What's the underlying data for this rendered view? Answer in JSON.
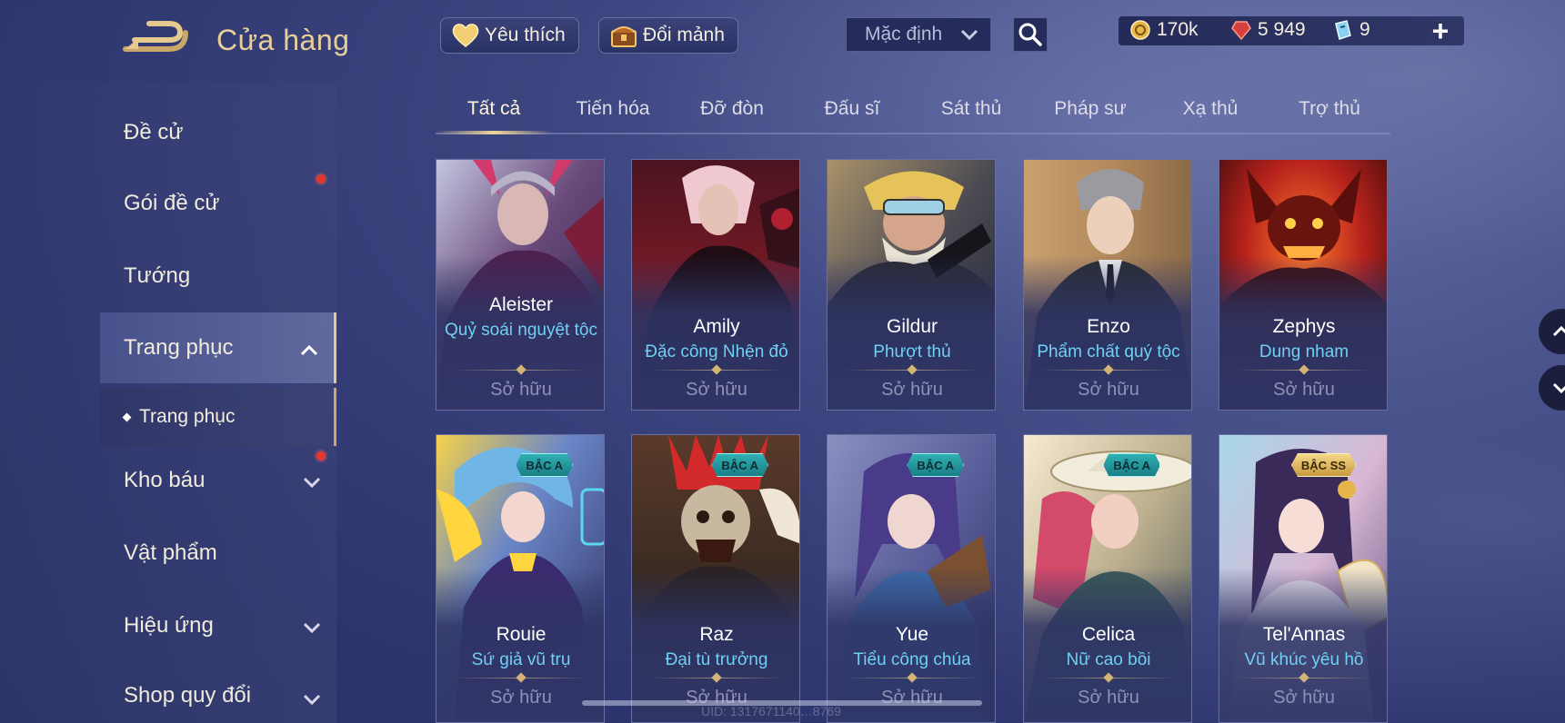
{
  "header": {
    "title": "Cửa hàng",
    "favorite_label": "Yêu thích",
    "exchange_label": "Đổi mảnh",
    "sort_value": "Mặc định",
    "back_icon": "back-arrow-icon",
    "search_icon": "search-icon"
  },
  "currencies": {
    "gold": "170k",
    "ruby": "5 949",
    "ticket": "9",
    "add": "+"
  },
  "sidebar": {
    "items": [
      {
        "label": "Đề cử"
      },
      {
        "label": "Gói đề cử"
      },
      {
        "label": "Tướng"
      },
      {
        "label": "Trang phục"
      },
      {
        "label": "Kho báu"
      },
      {
        "label": "Vật phẩm"
      },
      {
        "label": "Hiệu ứng"
      },
      {
        "label": "Shop quy đổi"
      }
    ],
    "sub_item": "Trang phục"
  },
  "tabs": [
    {
      "label": "Tất cả"
    },
    {
      "label": "Tiến hóa"
    },
    {
      "label": "Đỡ đòn"
    },
    {
      "label": "Đấu sĩ"
    },
    {
      "label": "Sát thủ"
    },
    {
      "label": "Pháp sư"
    },
    {
      "label": "Xạ thủ"
    },
    {
      "label": "Trợ thủ"
    }
  ],
  "cards": [
    {
      "hero": "Aleister",
      "skin": "Quỷ soái nguyệt tộc",
      "status": "Sở hữu",
      "tier": ""
    },
    {
      "hero": "Amily",
      "skin": "Đặc công Nhện đỏ",
      "status": "Sở hữu",
      "tier": ""
    },
    {
      "hero": "Gildur",
      "skin": "Phượt thủ",
      "status": "Sở hữu",
      "tier": ""
    },
    {
      "hero": "Enzo",
      "skin": "Phẩm chất quý tộc",
      "status": "Sở hữu",
      "tier": ""
    },
    {
      "hero": "Zephys",
      "skin": "Dung nham",
      "status": "Sở hữu",
      "tier": ""
    },
    {
      "hero": "Rouie",
      "skin": "Sứ giả vũ trụ",
      "status": "Sở hữu",
      "tier": "BẬC A"
    },
    {
      "hero": "Raz",
      "skin": "Đại tù trưởng",
      "status": "Sở hữu",
      "tier": "BẬC A"
    },
    {
      "hero": "Yue",
      "skin": "Tiểu công chúa",
      "status": "Sở hữu",
      "tier": "BẬC A"
    },
    {
      "hero": "Celica",
      "skin": "Nữ cao bồi",
      "status": "Sở hữu",
      "tier": "BẬC A"
    },
    {
      "hero": "Tel'Annas",
      "skin": "Vũ khúc yêu hồ",
      "status": "Sở hữu",
      "tier": "BẬC SS"
    }
  ],
  "footer": {
    "uid": "UID: 1317671140…8769"
  },
  "colors": {
    "accent_gold": "#e8cf9a",
    "skin_name": "#6fd0f5",
    "tier_a": "#2fb0b2",
    "tier_ss": "#f4d888",
    "notify_dot": "#e6372e"
  }
}
